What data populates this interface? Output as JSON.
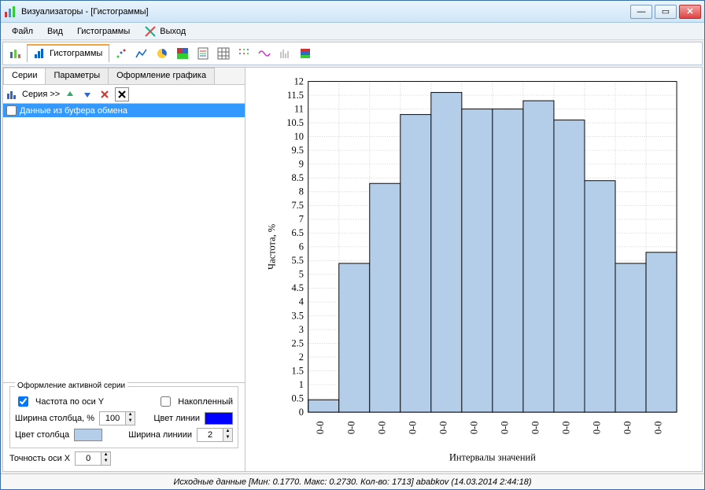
{
  "window": {
    "title": "Визуализаторы - [Гистограммы]"
  },
  "menu": {
    "file": "Файл",
    "view": "Вид",
    "hist": "Гистограммы",
    "exit": "Выход"
  },
  "toolbar_tab": "Гистограммы",
  "subtabs": {
    "series": "Серии",
    "params": "Параметры",
    "format": "Оформление графика"
  },
  "seriesbar": {
    "label": "Серия >>"
  },
  "series_item": "Данные из буфера обмена",
  "panel": {
    "group_title": "Оформление активной серии",
    "freq_y": "Частота по оси Y",
    "cumulative": "Накопленный",
    "col_width": "Ширина столбца, %",
    "col_width_val": "100",
    "line_color": "Цвет линии",
    "col_color": "Цвет столбца",
    "line_width": "Ширина линиии",
    "line_width_val": "2",
    "x_prec": "Точность оси X",
    "x_prec_val": "0"
  },
  "status": "Исходные данные [Мин: 0.1770. Макс: 0.2730. Кол-во: 1713] ababkov (14.03.2014 2:44:18)",
  "chart_data": {
    "type": "bar",
    "categories": [
      "0-0",
      "0-0",
      "0-0",
      "0-0",
      "0-0",
      "0-0",
      "0-0",
      "0-0",
      "0-0",
      "0-0",
      "0-0",
      "0-0"
    ],
    "values": [
      0.45,
      5.4,
      8.3,
      10.8,
      11.6,
      11.0,
      11.0,
      11.3,
      10.6,
      8.4,
      5.4,
      5.8
    ],
    "ylabel": "Частота, %",
    "xlabel": "Интервалы значений",
    "ylim": [
      0,
      12
    ],
    "ytick": 0.5
  },
  "colors": {
    "bar_fill": "#b4cde8",
    "bar_stroke": "#000",
    "line_swatch": "#0000ff",
    "col_swatch": "#b4cde8"
  }
}
